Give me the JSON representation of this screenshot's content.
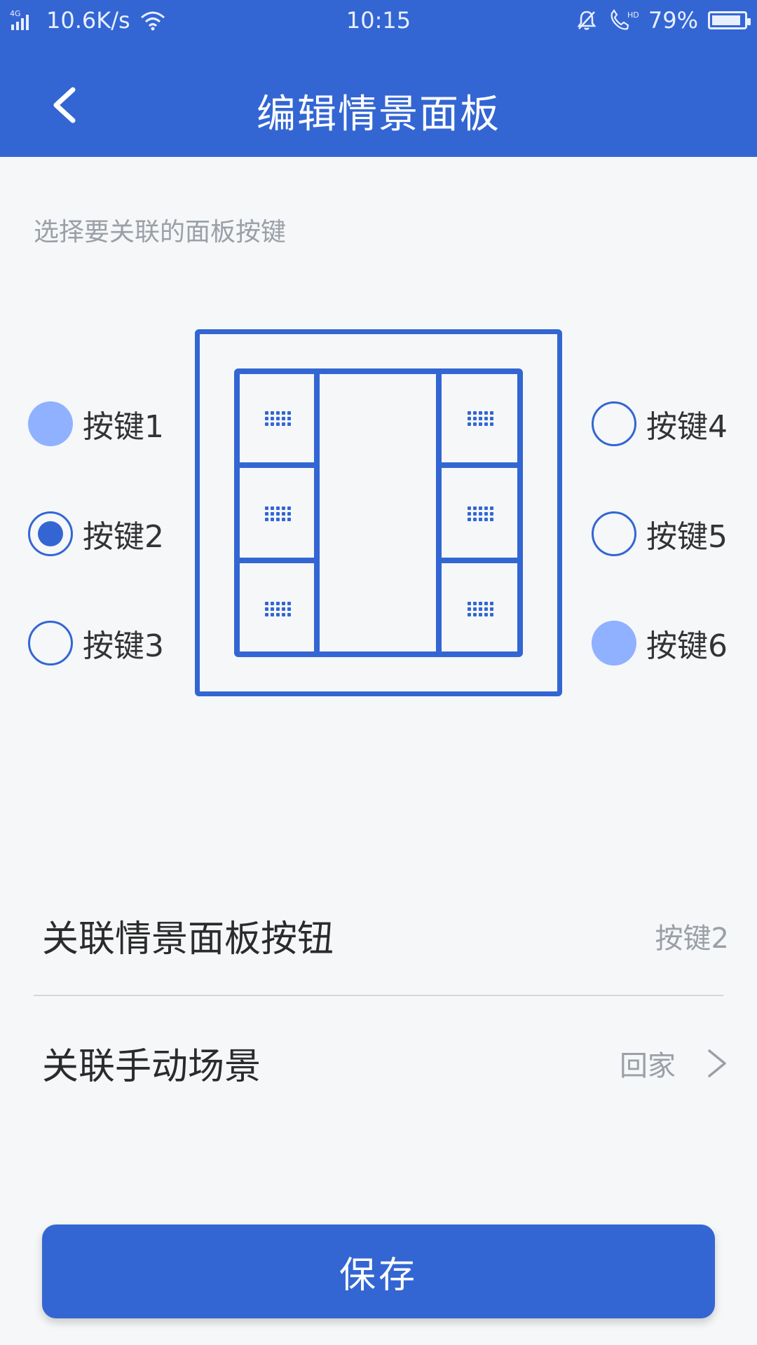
{
  "status_bar": {
    "network": "4G",
    "speed": "10.6K/s",
    "time": "10:15",
    "battery": "79%"
  },
  "header": {
    "title": "编辑情景面板"
  },
  "content": {
    "subtitle": "选择要关联的面板按键",
    "options": [
      {
        "label": "按键1",
        "state": "filled"
      },
      {
        "label": "按键2",
        "state": "selected"
      },
      {
        "label": "按键3",
        "state": "empty"
      },
      {
        "label": "按键4",
        "state": "empty"
      },
      {
        "label": "按键5",
        "state": "empty"
      },
      {
        "label": "按键6",
        "state": "filled"
      }
    ],
    "rows": [
      {
        "label": "关联情景面板按钮",
        "value": "按键2"
      },
      {
        "label": "关联手动场景",
        "value": "回家"
      }
    ]
  },
  "footer": {
    "save_label": "保存"
  },
  "colors": {
    "primary": "#3366d3",
    "light": "#8fb1ff"
  },
  "icons": {
    "back": "chevron-left-icon",
    "wifi": "wifi-icon",
    "signal": "signal-icon",
    "bell": "bell-off-icon",
    "phone": "phone-hd-icon",
    "battery": "battery-icon",
    "chevron": "chevron-right-icon"
  }
}
